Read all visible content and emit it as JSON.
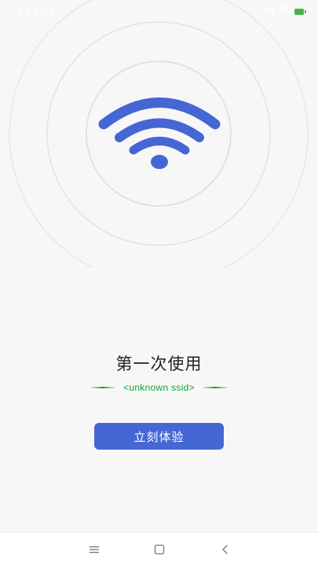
{
  "status_bar": {
    "time": "下午2:27",
    "signal_icon": "signal-icon",
    "wifi_icon": "wifi-status-icon",
    "battery_icon": "battery-icon"
  },
  "colors": {
    "accent": "#4567d4",
    "ring": "#dfe3ee",
    "ssid": "#19a22d",
    "background": "#f7f7f8"
  },
  "hero": {
    "icon": "wifi-icon"
  },
  "main": {
    "title": "第一次使用",
    "ssid": "<unknown ssid>",
    "button_label": "立刻体验"
  },
  "nav": {
    "menu_icon": "menu-icon",
    "home_icon": "home-icon",
    "back_icon": "back-icon"
  }
}
